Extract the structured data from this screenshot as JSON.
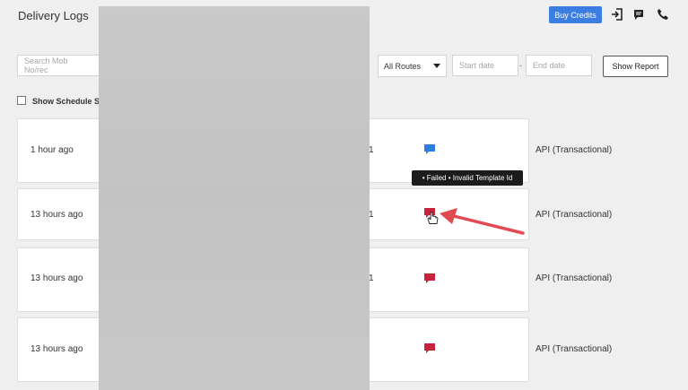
{
  "header": {
    "title": "Delivery Logs",
    "buy_credits_label": "Buy Credits",
    "icons": [
      "signout-icon",
      "message-icon",
      "phone-icon"
    ]
  },
  "filters": {
    "search_placeholder": "Search Mob No/rec",
    "route_value": "All Routes",
    "start_date_placeholder": "Start date",
    "date_separator": "-",
    "end_date_placeholder": "End date",
    "show_report_label": "Show Report",
    "show_schedule_label": "Show Schedule SI"
  },
  "tooltip": {
    "text": "• Failed • Invalid Template Id"
  },
  "rows": [
    {
      "time": "1 hour ago",
      "digit": "1",
      "status_color": "#2f7de1",
      "route": "API (Transactional)"
    },
    {
      "time": "13 hours ago",
      "digit": "1",
      "status_color": "#c8233d",
      "route": "API (Transactional)"
    },
    {
      "time": "13 hours ago",
      "digit": "1",
      "status_color": "#c8233d",
      "route": "API (Transactional)"
    },
    {
      "time": "13 hours ago",
      "digit": "1",
      "status_color": "#c8233d",
      "route": "API (Transactional)"
    }
  ],
  "colors": {
    "accent": "#3b7de0",
    "annotation_arrow": "#e24a52"
  }
}
